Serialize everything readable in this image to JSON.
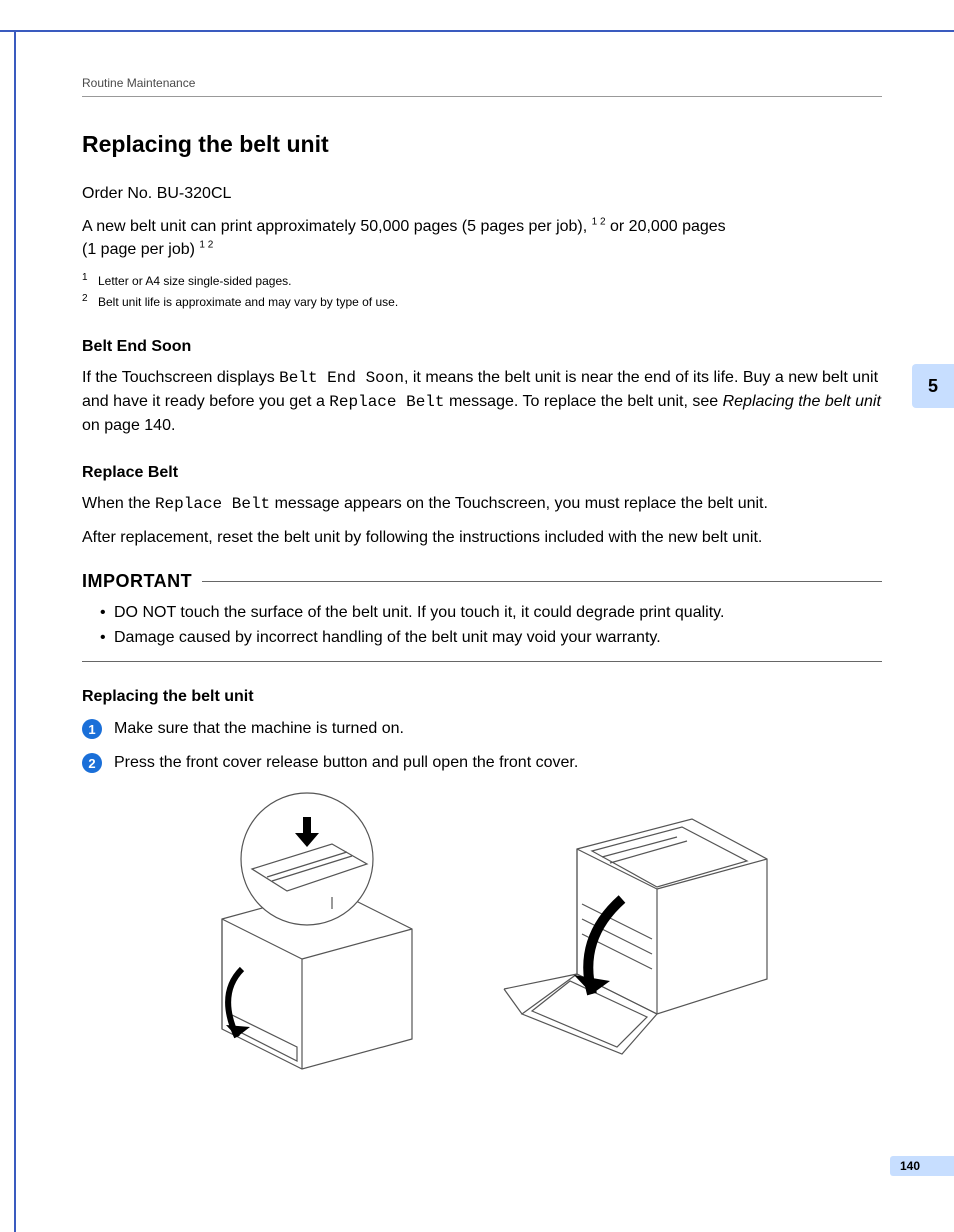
{
  "running_head": "Routine Maintenance",
  "title": "Replacing the belt unit",
  "order_line": "Order No.  BU-320CL",
  "capacity_a": "A new belt unit can print approximately 50,000 pages (5 pages per job), ",
  "capacity_sup": "1 2",
  "capacity_b": " or 20,000 pages ",
  "capacity_c": "(1 page per job) ",
  "footnotes": [
    {
      "n": "1",
      "t": "Letter or A4 size single-sided pages."
    },
    {
      "n": "2",
      "t": "Belt unit life is approximate and may vary by type of use."
    }
  ],
  "sec1_h": "Belt End Soon",
  "sec1_a": "If the Touchscreen displays ",
  "sec1_mono1": "Belt End Soon",
  "sec1_b": ", it means the belt unit is near the end of its life. Buy a new belt unit and have it ready before you get a ",
  "sec1_mono2": "Replace Belt",
  "sec1_c": " message. To replace the belt unit, see ",
  "sec1_link": "Replacing the belt unit",
  "sec1_d": " on page 140.",
  "sec2_h": "Replace Belt",
  "sec2_a": "When the ",
  "sec2_mono": "Replace Belt",
  "sec2_b": " message appears on the Touchscreen, you must replace the belt unit.",
  "sec2_p2": "After replacement, reset the belt unit by following the instructions included with the new belt unit.",
  "important_label": "IMPORTANT",
  "important_bullets": [
    "DO NOT touch the surface of the belt unit. If you touch it, it could degrade print quality.",
    "Damage caused by incorrect handling of the belt unit may void your warranty."
  ],
  "sec3_h": "Replacing the belt unit",
  "steps": [
    {
      "n": "1",
      "t": "Make sure that the machine is turned on."
    },
    {
      "n": "2",
      "t": "Press the front cover release button and pull open the front cover."
    }
  ],
  "chapter_tab": "5",
  "page_number": "140"
}
